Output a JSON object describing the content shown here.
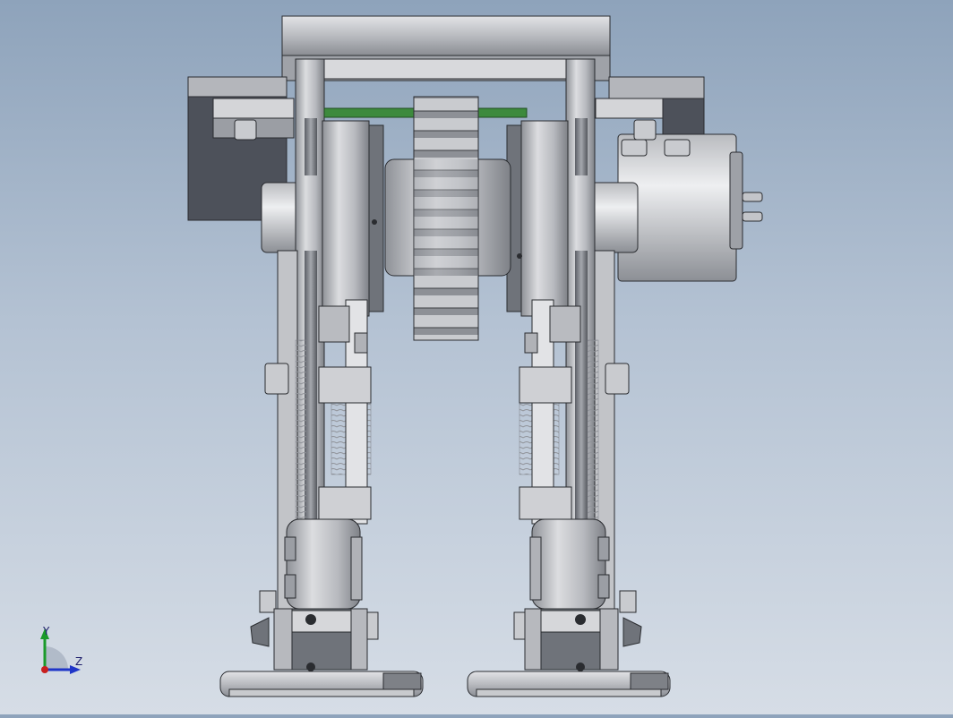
{
  "viewport": {
    "background_top": "#8ea3bb",
    "background_bottom": "#d6dde6",
    "model_palette": {
      "metal_light": "#d2d4d8",
      "metal_mid": "#a9acb2",
      "metal_dark": "#6f737a",
      "motor_dark": "#4d515a",
      "belt_green": "#3d8a3d",
      "edge": "#2a2c30"
    }
  },
  "triad": {
    "y_label": "Y",
    "z_label": "Z",
    "y_color": "#1a9a2a",
    "z_color": "#1f35c8",
    "x_color": "#c81f1f"
  }
}
